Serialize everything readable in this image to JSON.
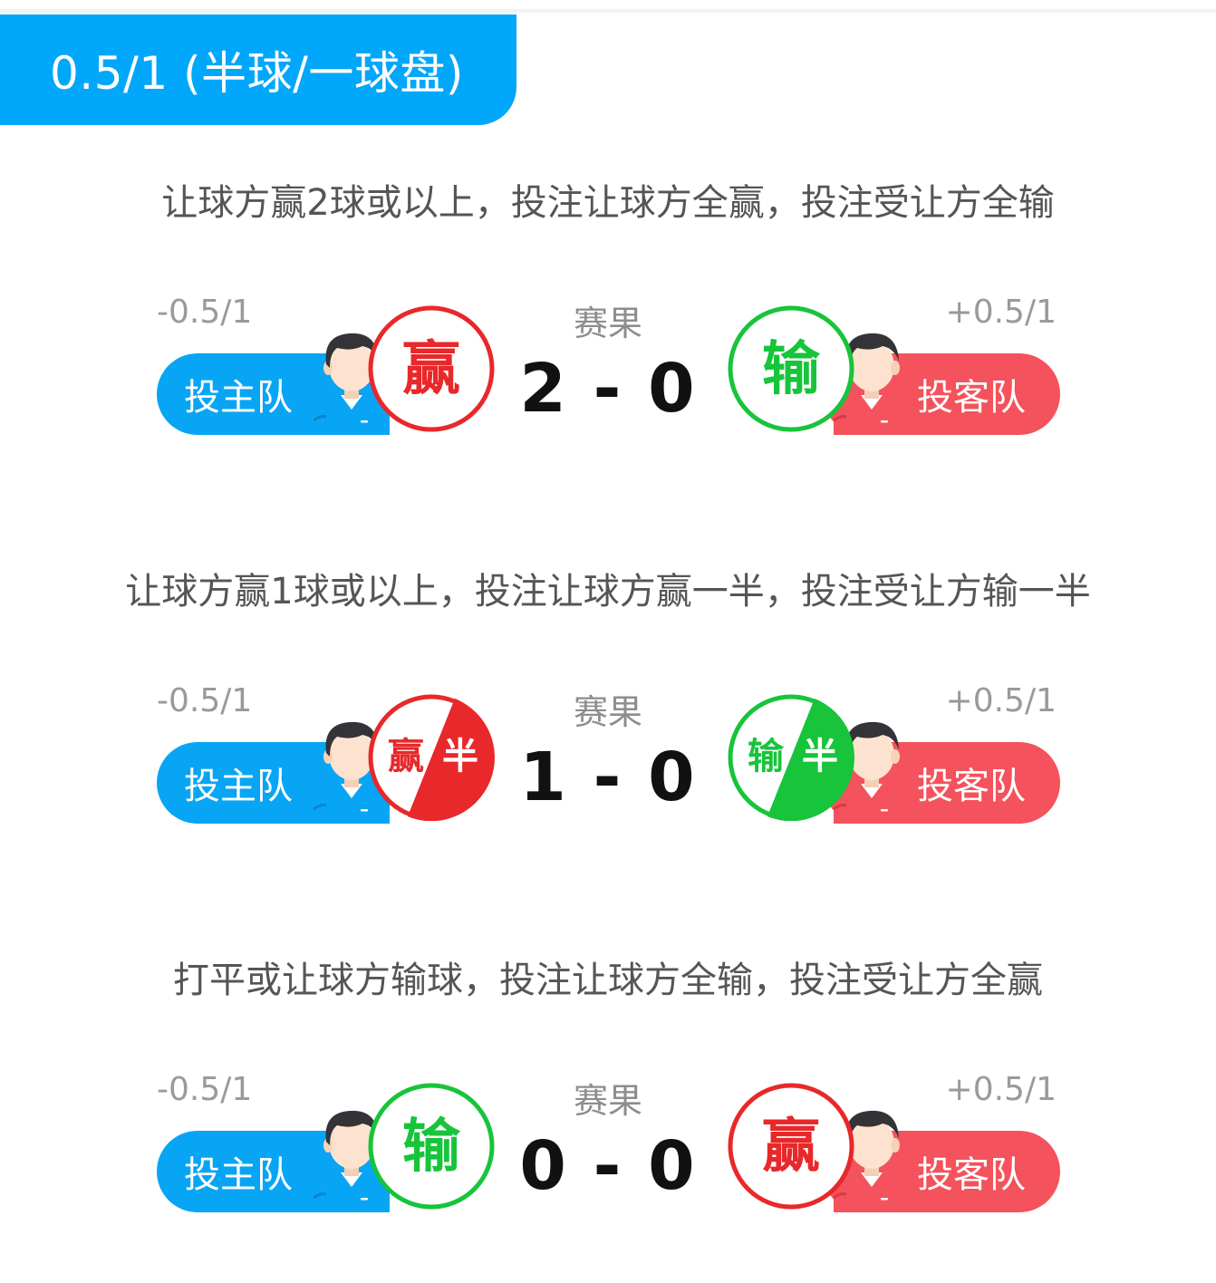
{
  "header": {
    "title": "0.5/1 (半球/一球盘)"
  },
  "colors": {
    "accent_blue": "#00a7fa",
    "home_blue": "#08a5f4",
    "away_red": "#f4525c",
    "win_red": "#e8282a",
    "lose_green": "#17c43a"
  },
  "sections": [
    {
      "description": "让球方赢2球或以上，投注让球方全赢，投注受让方全输",
      "home_handicap": "-0.5/1",
      "away_handicap": "+0.5/1",
      "result_label": "赛果",
      "score": "2 - 0",
      "home_label": "投主队",
      "away_label": "投客队",
      "home_badge": {
        "type": "full",
        "outcome": "win",
        "text": "赢"
      },
      "away_badge": {
        "type": "full",
        "outcome": "lose",
        "text": "输"
      }
    },
    {
      "description": "让球方赢1球或以上，投注让球方赢一半，投注受让方输一半",
      "home_handicap": "-0.5/1",
      "away_handicap": "+0.5/1",
      "result_label": "赛果",
      "score": "1 - 0",
      "home_label": "投主队",
      "away_label": "投客队",
      "home_badge": {
        "type": "half",
        "outcome": "win",
        "text": "赢",
        "half_text": "半"
      },
      "away_badge": {
        "type": "half",
        "outcome": "lose",
        "text": "输",
        "half_text": "半"
      }
    },
    {
      "description": "打平或让球方输球，投注让球方全输，投注受让方全赢",
      "home_handicap": "-0.5/1",
      "away_handicap": "+0.5/1",
      "result_label": "赛果",
      "score": "0 - 0",
      "home_label": "投主队",
      "away_label": "投客队",
      "home_badge": {
        "type": "full",
        "outcome": "lose",
        "text": "输"
      },
      "away_badge": {
        "type": "full",
        "outcome": "win",
        "text": "赢"
      }
    }
  ]
}
